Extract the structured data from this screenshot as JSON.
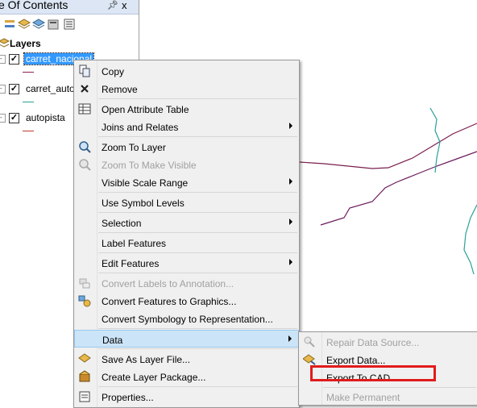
{
  "toc": {
    "title": "e Of Contents",
    "pin_icon": "pin-icon",
    "close_glyph": "x",
    "layers_label": "Layers",
    "layers": [
      {
        "name": "carret_nacional",
        "checked": true,
        "selected": true,
        "color": "#8b1e52"
      },
      {
        "name": "carret_auto",
        "checked": true,
        "selected": false,
        "color": "#2aa198"
      },
      {
        "name": "autopista",
        "checked": true,
        "selected": false,
        "color": "#c0392b"
      }
    ]
  },
  "context_menu": {
    "items": [
      {
        "label": "Copy",
        "icon": "copy-icon",
        "disabled": false,
        "submenu": false
      },
      {
        "label": "Remove",
        "icon": "remove-icon",
        "disabled": false,
        "submenu": false
      },
      {
        "label": "Open Attribute Table",
        "icon": "table-icon",
        "disabled": false,
        "submenu": false
      },
      {
        "label": "Joins and Relates",
        "icon": "",
        "disabled": false,
        "submenu": true
      },
      {
        "label": "Zoom To Layer",
        "icon": "zoom-layer-icon",
        "disabled": false,
        "submenu": false
      },
      {
        "label": "Zoom To Make Visible",
        "icon": "zoom-visible-icon",
        "disabled": true,
        "submenu": false
      },
      {
        "label": "Visible Scale Range",
        "icon": "",
        "disabled": false,
        "submenu": true
      },
      {
        "label": "Use Symbol Levels",
        "icon": "",
        "disabled": false,
        "submenu": false
      },
      {
        "label": "Selection",
        "icon": "",
        "disabled": false,
        "submenu": true
      },
      {
        "label": "Label Features",
        "icon": "",
        "disabled": false,
        "submenu": false
      },
      {
        "label": "Edit Features",
        "icon": "",
        "disabled": false,
        "submenu": true
      },
      {
        "label": "Convert Labels to Annotation...",
        "icon": "convert-labels-icon",
        "disabled": true,
        "submenu": false
      },
      {
        "label": "Convert Features to Graphics...",
        "icon": "convert-graphics-icon",
        "disabled": false,
        "submenu": false
      },
      {
        "label": "Convert Symbology to Representation...",
        "icon": "",
        "disabled": false,
        "submenu": false
      },
      {
        "label": "Data",
        "icon": "",
        "disabled": false,
        "submenu": true,
        "highlighted": true
      },
      {
        "label": "Save As Layer File...",
        "icon": "layer-file-icon",
        "disabled": false,
        "submenu": false
      },
      {
        "label": "Create Layer Package...",
        "icon": "layer-package-icon",
        "disabled": false,
        "submenu": false
      },
      {
        "label": "Properties...",
        "icon": "properties-icon",
        "disabled": false,
        "submenu": false
      }
    ]
  },
  "data_submenu": {
    "items": [
      {
        "label": "Repair Data Source...",
        "icon": "repair-icon",
        "disabled": true
      },
      {
        "label": "Export Data...",
        "icon": "export-data-icon",
        "disabled": false
      },
      {
        "label": "Export To CAD...",
        "icon": "",
        "disabled": false,
        "annotated": true
      },
      {
        "label": "Make Permanent",
        "icon": "",
        "disabled": true
      }
    ]
  },
  "colors": {
    "annotation_box": "#e11b1b",
    "highlight": "#cce4f7",
    "selection": "#3399ff"
  }
}
